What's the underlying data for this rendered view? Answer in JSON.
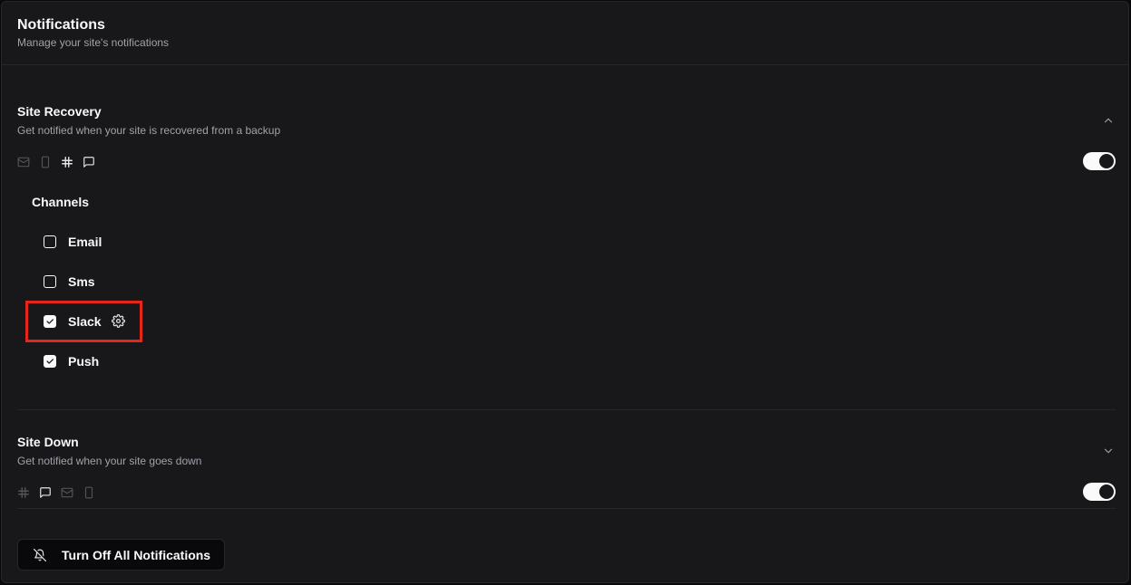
{
  "header": {
    "title": "Notifications",
    "subtitle": "Manage your site's notifications"
  },
  "sections": [
    {
      "title": "Site Recovery",
      "description": "Get notified when your site is recovered from a backup",
      "expanded": true,
      "enabled": true,
      "channel_icons": [
        "email-icon",
        "phone-icon",
        "slack-icon",
        "message-icon"
      ],
      "channels_label": "Channels",
      "channels": [
        {
          "label": "Email",
          "checked": false
        },
        {
          "label": "Sms",
          "checked": false
        },
        {
          "label": "Slack",
          "checked": true,
          "has_settings": true
        },
        {
          "label": "Push",
          "checked": true
        }
      ]
    },
    {
      "title": "Site Down",
      "description": "Get notified when your site goes down",
      "expanded": false,
      "enabled": true,
      "channel_icons": [
        "slack-icon",
        "message-icon",
        "email-icon",
        "phone-icon"
      ]
    }
  ],
  "footer": {
    "turn_off_label": "Turn Off All Notifications"
  },
  "colors": {
    "background": "#18181b",
    "border": "#27272a",
    "muted_text": "#a1a1aa",
    "highlight": "#e5261b"
  }
}
